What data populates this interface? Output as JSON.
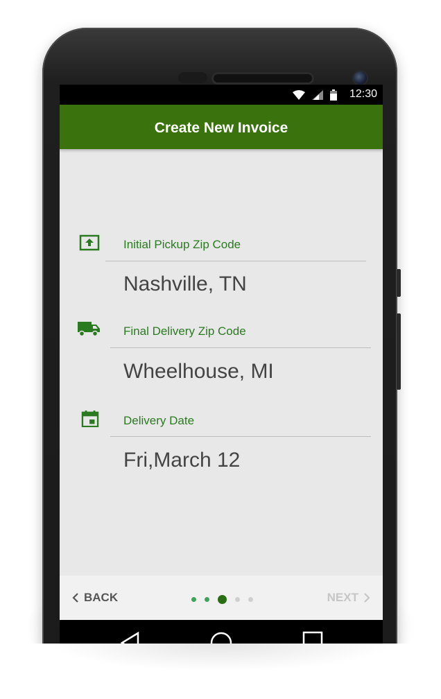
{
  "status_bar": {
    "time": "12:30",
    "icons": [
      "wifi-icon",
      "signal-icon",
      "battery-icon"
    ]
  },
  "app_bar": {
    "title": "Create New Invoice"
  },
  "fields": [
    {
      "label": "Initial Pickup Zip Code",
      "value": "Nashville, TN",
      "icon": "pickup-box-icon"
    },
    {
      "label": "Final Delivery Zip Code",
      "value": "Wheelhouse, MI",
      "icon": "truck-icon"
    },
    {
      "label": "Delivery Date",
      "value": "Fri,March 12",
      "icon": "calendar-icon"
    }
  ],
  "footer": {
    "back_label": "BACK",
    "next_label": "NEXT",
    "pager": {
      "total": 5,
      "current": 3
    }
  },
  "nav_bar": {
    "icons": [
      "back-triangle-icon",
      "home-circle-icon",
      "recents-square-icon"
    ]
  },
  "colors": {
    "primary": "#3a720e",
    "label_green": "#2a7a20",
    "value_text": "#444444",
    "screen_bg": "#e8e8e8"
  }
}
